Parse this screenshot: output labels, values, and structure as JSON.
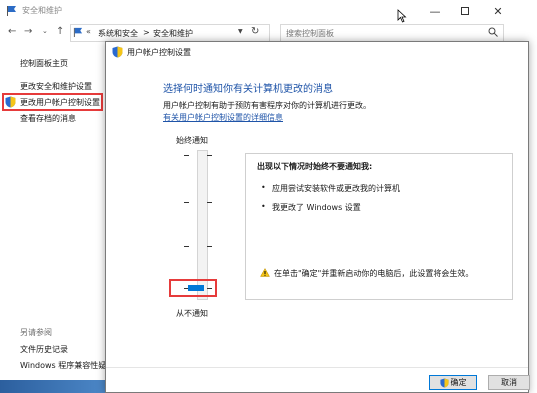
{
  "colors": {
    "accent": "#1f54a8",
    "highlight": "#e63b3b",
    "thumb": "#0078d7"
  },
  "bg_window": {
    "title": "安全和维护",
    "address": {
      "crumbs": [
        "系统和安全",
        "安全和维护"
      ],
      "separator": ">"
    },
    "search_placeholder": "搜索控制面板",
    "sidebar": {
      "home": "控制面板主页",
      "items": [
        "更改安全和维护设置",
        "更改用户帐户控制设置",
        "查看存档的消息"
      ],
      "see_also_title": "另请参阅",
      "see_also": [
        "文件历史记录",
        "Windows 程序兼容性疑"
      ]
    }
  },
  "dialog": {
    "title": "用户帐户控制设置",
    "heading": "选择何时通知你有关计算机更改的消息",
    "description": "用户帐户控制有助于预防有害程序对你的计算机进行更改。",
    "link": "有关用户帐户控制设置的详细信息",
    "slider": {
      "top_label": "始终通知",
      "bottom_label": "从不通知",
      "level": 0,
      "levels": 4
    },
    "info": {
      "title": "出现以下情况时始终不要通知我:",
      "bullets": [
        "应用尝试安装软件或更改我的计算机",
        "我更改了 Windows 设置"
      ],
      "warning": "在单击\"确定\"并重新启动你的电脑后，此设置将会生效。"
    },
    "buttons": {
      "ok": "确定",
      "cancel": "取消"
    }
  }
}
